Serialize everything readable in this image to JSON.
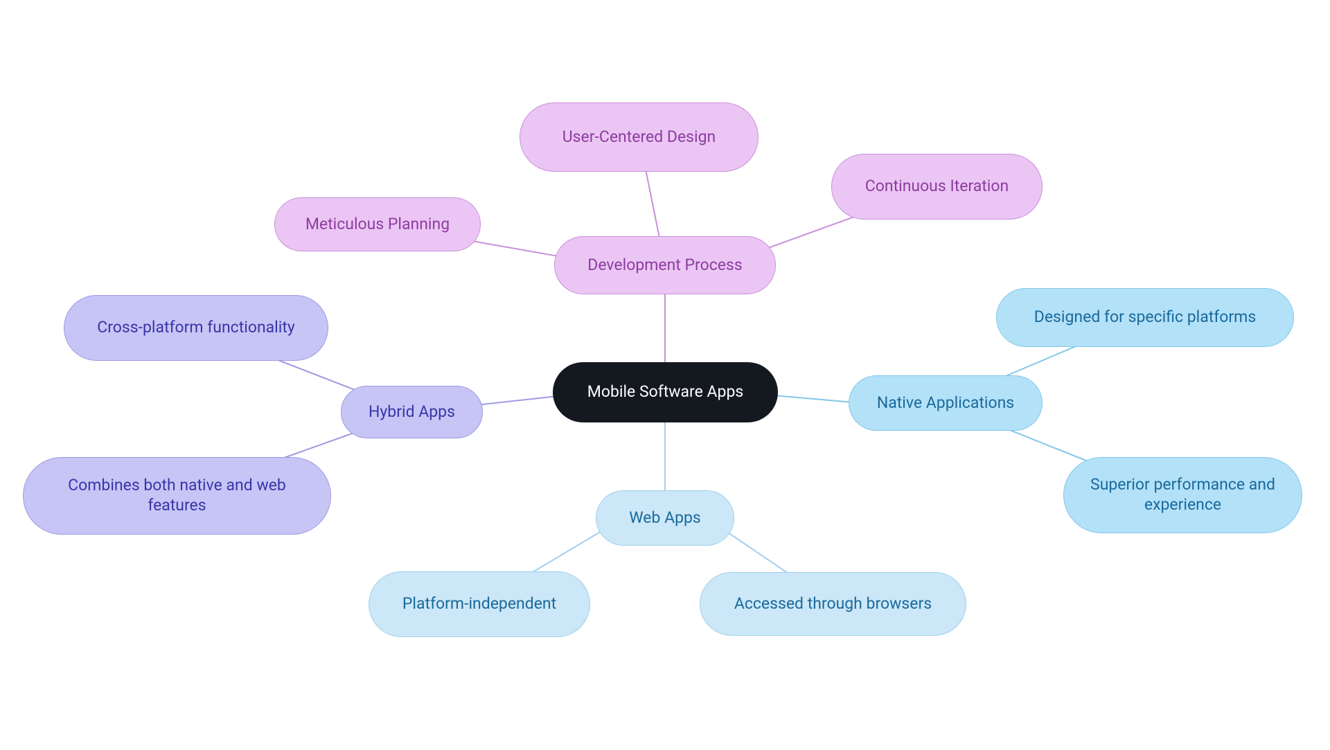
{
  "center": {
    "label": "Mobile Software Apps"
  },
  "branches": {
    "dev": {
      "label": "Development Process",
      "children": [
        {
          "label": "Meticulous Planning"
        },
        {
          "label": "User-Centered Design"
        },
        {
          "label": "Continuous Iteration"
        }
      ]
    },
    "native": {
      "label": "Native Applications",
      "children": [
        {
          "label": "Designed for specific platforms"
        },
        {
          "label": "Superior performance and experience"
        }
      ]
    },
    "web": {
      "label": "Web Apps",
      "children": [
        {
          "label": "Platform-independent"
        },
        {
          "label": "Accessed through browsers"
        }
      ]
    },
    "hybrid": {
      "label": "Hybrid Apps",
      "children": [
        {
          "label": "Cross-platform functionality"
        },
        {
          "label": "Combines both native and web features"
        }
      ]
    }
  }
}
